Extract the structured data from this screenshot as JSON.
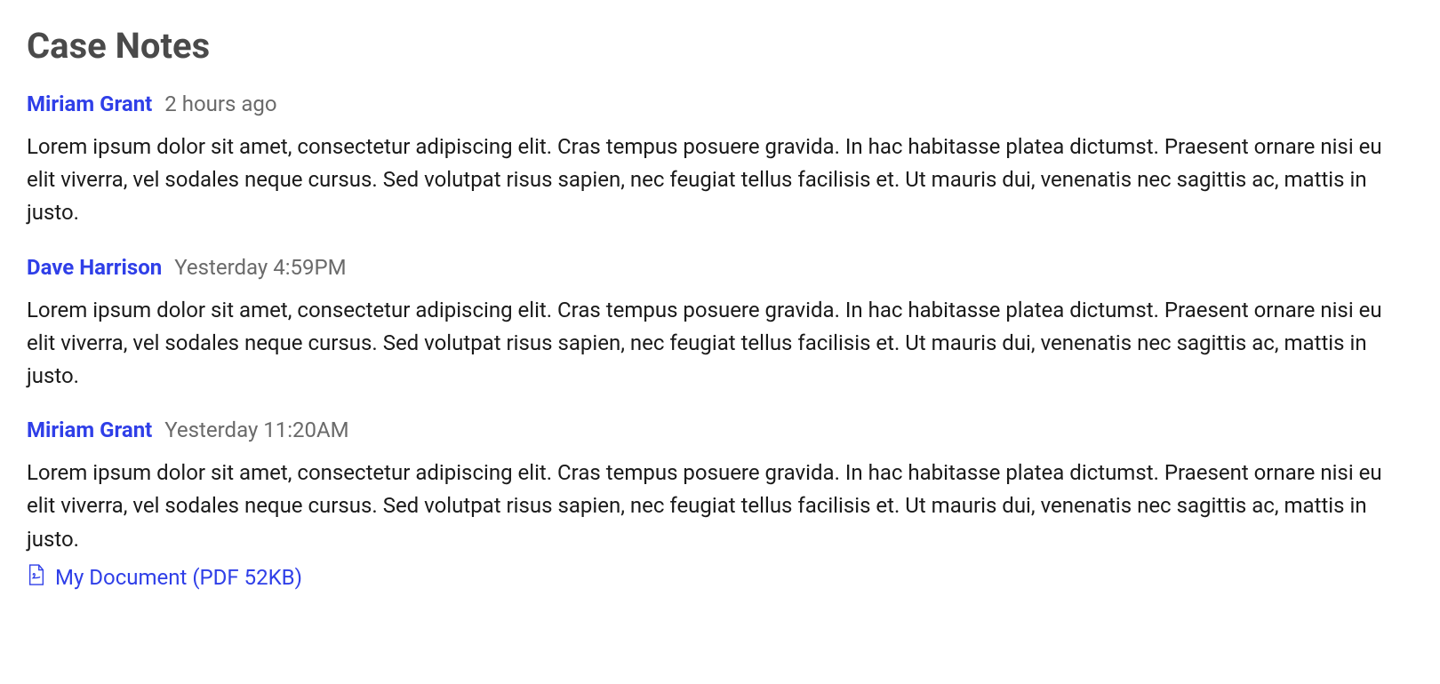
{
  "title": "Case Notes",
  "notes": [
    {
      "author": "Miriam Grant",
      "time": "2 hours ago",
      "body": "Lorem ipsum dolor sit amet, consectetur adipiscing elit. Cras tempus posuere gravida. In hac habitasse platea dictumst. Praesent ornare nisi eu elit viverra, vel sodales neque cursus. Sed volutpat risus sapien, nec feugiat tellus facilisis et. Ut mauris dui, venenatis nec sagittis ac, mattis in justo."
    },
    {
      "author": "Dave Harrison",
      "time": "Yesterday 4:59PM",
      "body": "Lorem ipsum dolor sit amet, consectetur adipiscing elit. Cras tempus posuere gravida. In hac habitasse platea dictumst. Praesent ornare nisi eu elit viverra, vel sodales neque cursus. Sed volutpat risus sapien, nec feugiat tellus facilisis et. Ut mauris dui, venenatis nec sagittis ac, mattis in justo."
    },
    {
      "author": "Miriam Grant",
      "time": "Yesterday 11:20AM",
      "body": "Lorem ipsum dolor sit amet, consectetur adipiscing elit. Cras tempus posuere gravida. In hac habitasse platea dictumst. Praesent ornare nisi eu elit viverra, vel sodales neque cursus. Sed volutpat risus sapien, nec feugiat tellus facilisis et. Ut mauris dui, venenatis nec sagittis ac, mattis in justo.",
      "attachment": {
        "label": "My Document (PDF 52KB)"
      }
    }
  ]
}
